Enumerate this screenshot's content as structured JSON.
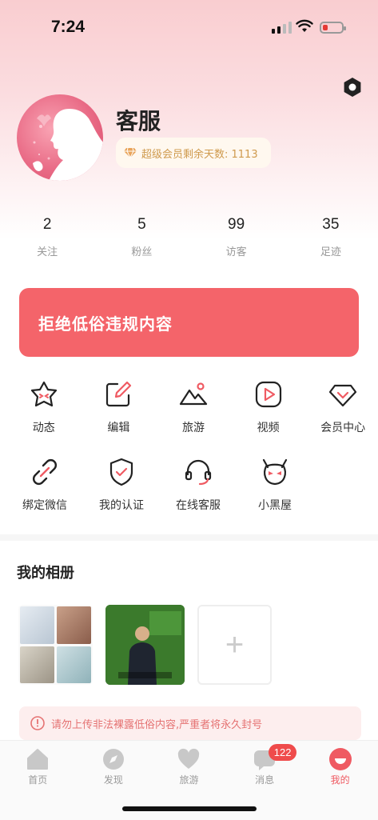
{
  "status_bar": {
    "time": "7:24",
    "battery_color": "#e53935"
  },
  "profile": {
    "username": "客服",
    "vip_text": "超级会员剩余天数: 1113",
    "icons": {
      "settings": "gear-icon",
      "vip": "diamond-icon"
    }
  },
  "stats": [
    {
      "value": "2",
      "label": "关注"
    },
    {
      "value": "5",
      "label": "粉丝"
    },
    {
      "value": "99",
      "label": "访客"
    },
    {
      "value": "35",
      "label": "足迹"
    }
  ],
  "banner": {
    "text": "拒绝低俗违规内容",
    "color": "#f4646a"
  },
  "menu": {
    "row1": [
      {
        "label": "动态",
        "icon": "star-face-icon"
      },
      {
        "label": "编辑",
        "icon": "edit-icon"
      },
      {
        "label": "旅游",
        "icon": "mountain-icon"
      },
      {
        "label": "视频",
        "icon": "play-icon"
      },
      {
        "label": "会员中心",
        "icon": "diamond-icon"
      }
    ],
    "row2": [
      {
        "label": "绑定微信",
        "icon": "link-icon"
      },
      {
        "label": "我的认证",
        "icon": "shield-check-icon"
      },
      {
        "label": "在线客服",
        "icon": "headset-icon"
      },
      {
        "label": "小黑屋",
        "icon": "devil-icon"
      }
    ],
    "accent": "#ef5a62"
  },
  "album": {
    "title": "我的相册",
    "add_label": "+"
  },
  "warning": {
    "text": "请勿上传非法裸露低俗内容,严重者将永久封号"
  },
  "tabbar": {
    "tabs": [
      {
        "label": "首页",
        "icon": "home-icon"
      },
      {
        "label": "发现",
        "icon": "compass-icon"
      },
      {
        "label": "旅游",
        "icon": "heart-icon"
      },
      {
        "label": "消息",
        "icon": "message-icon",
        "badge": "122"
      },
      {
        "label": "我的",
        "icon": "profile-icon",
        "active": true
      }
    ]
  }
}
